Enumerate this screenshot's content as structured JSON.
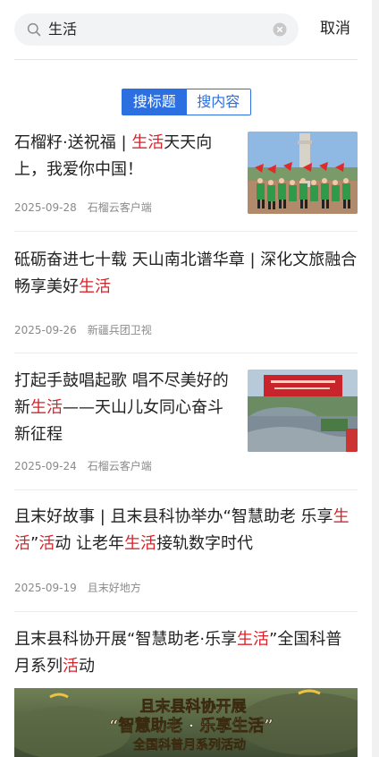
{
  "search": {
    "query": "生活",
    "cancel_label": "取消"
  },
  "tabs": [
    {
      "label": "搜标题"
    },
    {
      "label": "搜内容"
    }
  ],
  "articles": [
    {
      "title_parts": [
        "石榴籽·送祝福 | ",
        "生活",
        "天天向上，我爱你中国！"
      ],
      "date": "2025-09-28",
      "source": "石榴云客户端"
    },
    {
      "title_parts": [
        "砥砺奋进七十载 天山南北谱华章 | 深化文旅融合 畅享美好",
        "生活"
      ],
      "date": "2025-09-26",
      "source": "新疆兵团卫视"
    },
    {
      "title_parts": [
        "打起手鼓唱起歌 唱不尽美好的新",
        "生活",
        "——天山儿女同心奋斗新征程"
      ],
      "date": "2025-09-24",
      "source": "石榴云客户端"
    },
    {
      "title_parts": [
        "且末好故事 | 且末县科协举办“智慧助老 乐享",
        "生活",
        "”",
        "活",
        "动 让老年",
        "生活",
        "接轨数字时代"
      ],
      "date": "2025-09-19",
      "source": "且末好地方"
    },
    {
      "title_parts": [
        "且末县科协开展“智慧助老·乐享",
        "生活",
        "”全国科普月系列",
        "活",
        "动"
      ],
      "banner_lines": [
        "且末县科协开展",
        "“智慧助老 · 乐享生活”",
        "全国科普月系列活动"
      ]
    }
  ],
  "colors": {
    "accent": "#2c6fe0",
    "highlight": "#d9232a"
  }
}
